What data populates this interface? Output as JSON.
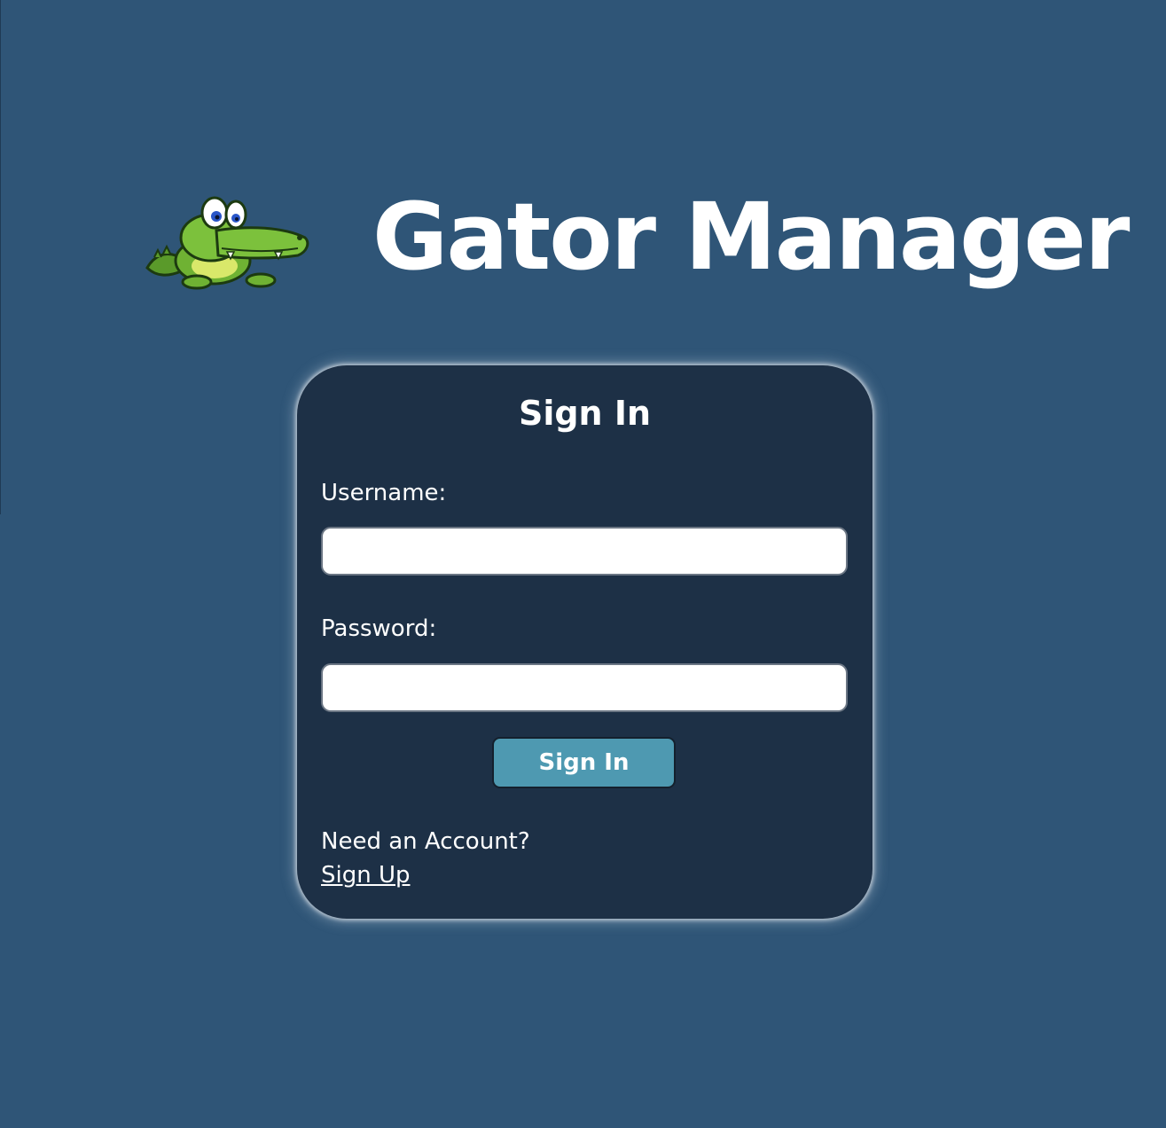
{
  "app": {
    "title": "Gator Manager",
    "logo_icon": "gator-mascot-icon"
  },
  "sign_in_form": {
    "heading": "Sign In",
    "username_label": "Username:",
    "username_value": "",
    "username_placeholder": "",
    "password_label": "Password:",
    "password_value": "",
    "password_placeholder": "",
    "submit_label": "Sign In",
    "account_prompt": "Need an Account?",
    "signup_link": "Sign Up"
  },
  "colors": {
    "background": "#2f5577",
    "card": "#1d3046",
    "button": "#4e99b1",
    "text": "#ffffff"
  }
}
